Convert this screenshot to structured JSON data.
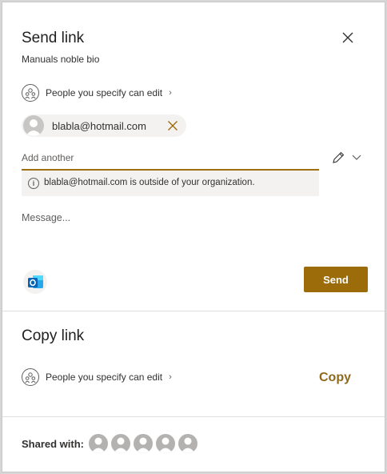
{
  "send_link": {
    "title": "Send link",
    "file_name": "Manuals noble bio",
    "permission_label": "People you specify can edit",
    "recipient": {
      "email": "blabla@hotmail.com"
    },
    "add_another_placeholder": "Add another",
    "warning_text": "blabla@hotmail.com is outside of your organization.",
    "message_placeholder": "Message...",
    "send_label": "Send",
    "outlook_icon": "outlook-icon"
  },
  "copy_link": {
    "title": "Copy link",
    "permission_label": "People you specify can edit",
    "copy_label": "Copy"
  },
  "shared_with": {
    "label": "Shared with:",
    "avatar_count": 5
  },
  "colors": {
    "accent": "#9c6c0a",
    "accent_text": "#8f6a1b",
    "outlook_blue": "#0364b8"
  }
}
